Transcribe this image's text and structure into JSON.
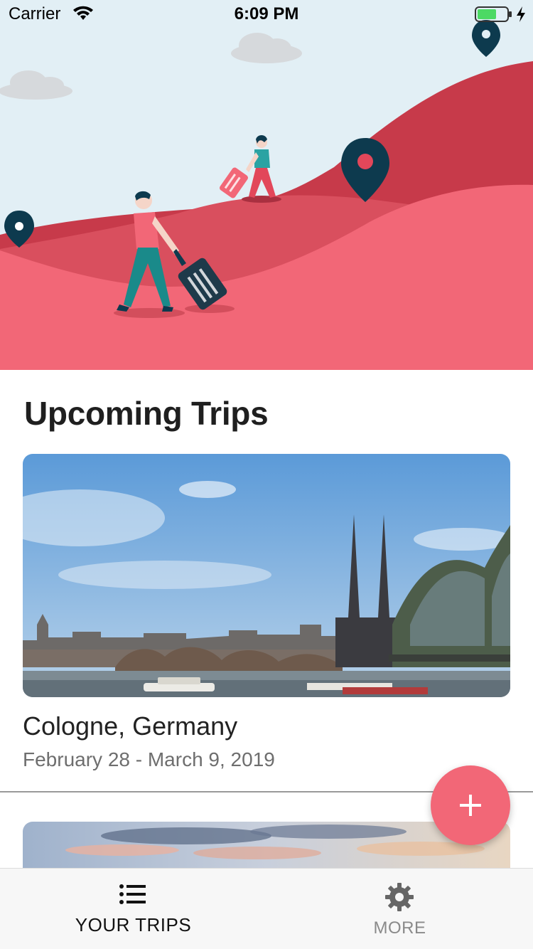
{
  "status_bar": {
    "carrier": "Carrier",
    "time": "6:09 PM"
  },
  "colors": {
    "accent": "#f26777",
    "hill_dark": "#c73a4a",
    "hill_light": "#f26777",
    "pin": "#0d3a4e",
    "sky": "#e2eff5"
  },
  "main": {
    "section_title": "Upcoming Trips",
    "trips": [
      {
        "city": "Cologne, Germany",
        "dates": "February 28 - March 9, 2019"
      }
    ]
  },
  "fab": {
    "icon": "plus-icon"
  },
  "tab_bar": {
    "tabs": [
      {
        "label": "YOUR TRIPS",
        "icon": "list-icon",
        "active": true
      },
      {
        "label": "MORE",
        "icon": "gear-icon",
        "active": false
      }
    ]
  }
}
